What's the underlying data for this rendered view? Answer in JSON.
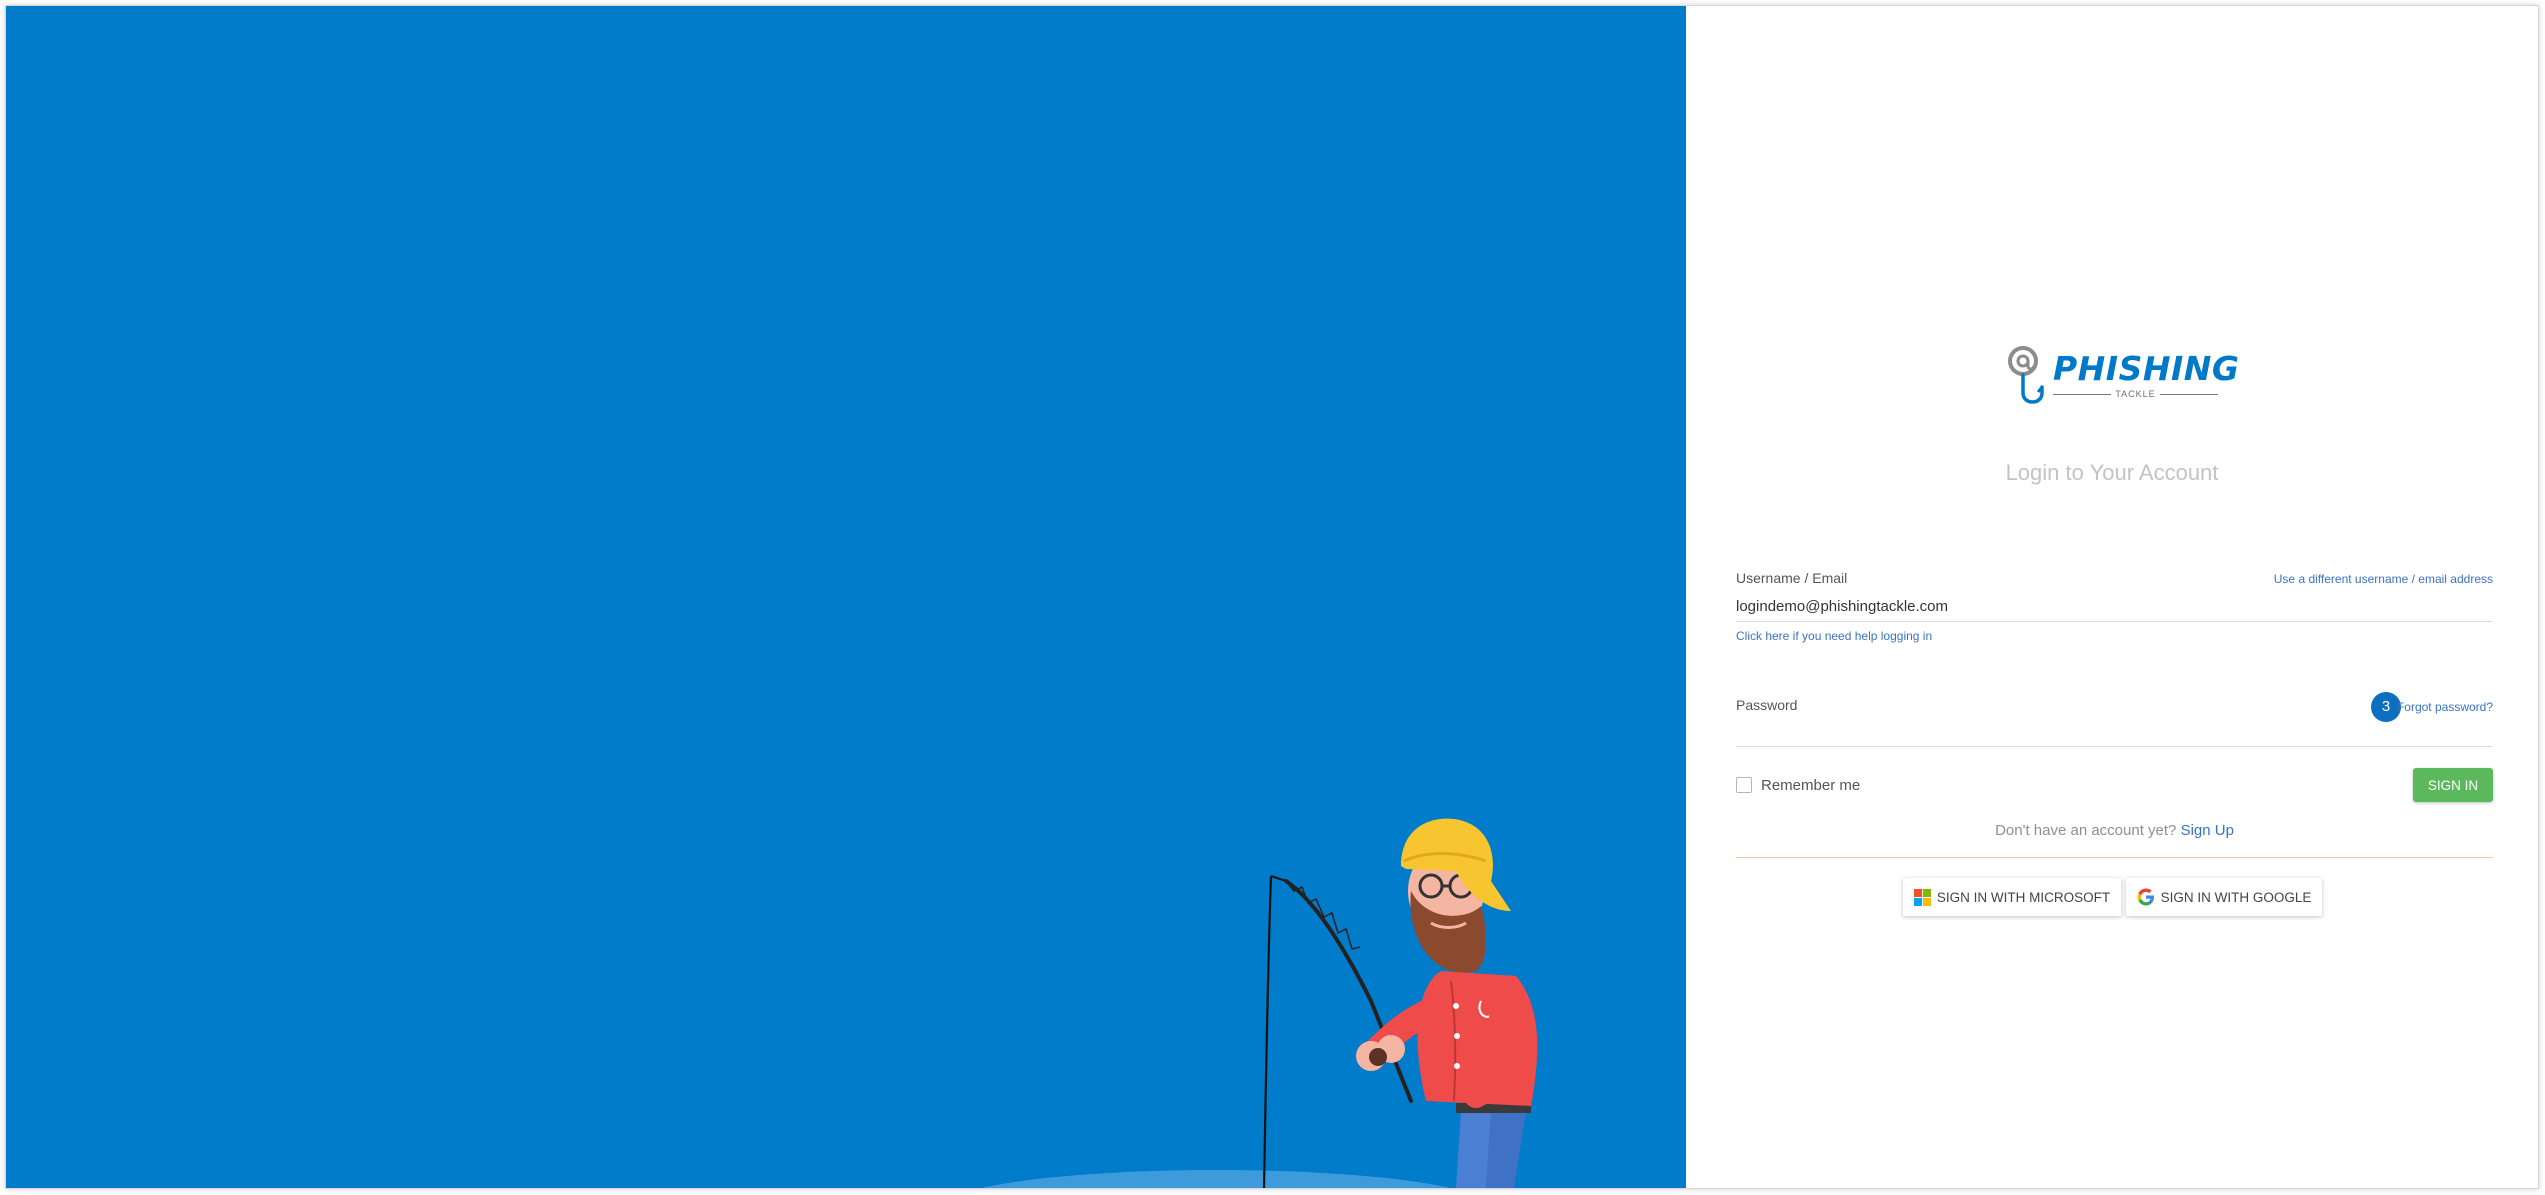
{
  "brand": {
    "name": "PHISHING",
    "sub": "TACKLE",
    "primary_color": "#0079c8",
    "panel_color": "#007ccb"
  },
  "login": {
    "heading": "Login to Your Account",
    "username_label": "Username / Email",
    "use_different_link": "Use a different username / email address",
    "username_value": "logindemo@phishingtackle.com",
    "help_link": "Click here if you need help logging in",
    "password_label": "Password",
    "badge_count": "3",
    "forgot_link": "Forgot password?",
    "remember_label": "Remember me",
    "signin_label": "SIGN IN",
    "signup_prompt": "Don't have an account yet?",
    "signup_link": "Sign Up",
    "microsoft_label": "SIGN IN WITH MICROSOFT",
    "google_label": "SIGN IN WITH GOOGLE"
  },
  "icons": {
    "microsoft": "microsoft-logo-icon",
    "google": "google-logo-icon",
    "logo_mark": "at-hook-icon"
  }
}
